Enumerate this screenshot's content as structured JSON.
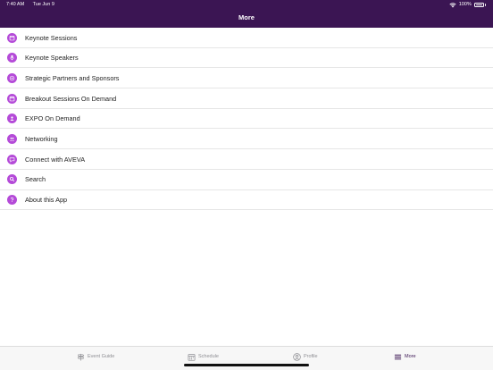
{
  "status_bar": {
    "time": "7:40 AM",
    "date": "Tue Jun 9",
    "battery": "100%"
  },
  "nav": {
    "title": "More"
  },
  "menu": [
    {
      "label": "Keynote Sessions",
      "icon": "calendar-icon"
    },
    {
      "label": "Keynote Speakers",
      "icon": "microphone-icon"
    },
    {
      "label": "Strategic Partners and Sponsors",
      "icon": "handshake-icon"
    },
    {
      "label": "Breakout Sessions On Demand",
      "icon": "calendar-icon"
    },
    {
      "label": "EXPO On Demand",
      "icon": "booth-icon"
    },
    {
      "label": "Networking",
      "icon": "people-icon"
    },
    {
      "label": "Connect with AVEVA",
      "icon": "chat-icon"
    },
    {
      "label": "Search",
      "icon": "search-icon"
    },
    {
      "label": "About this App",
      "icon": "question-icon"
    }
  ],
  "tabs": [
    {
      "label": "Event Guide",
      "icon": "signpost-icon"
    },
    {
      "label": "Schedule",
      "icon": "calendar-icon"
    },
    {
      "label": "Profile",
      "icon": "person-icon"
    },
    {
      "label": "More",
      "icon": "menu-icon"
    }
  ],
  "colors": {
    "header_bg": "#3b1553",
    "icon_accent": "#b44ad8",
    "active_tab": "#3b1553"
  }
}
